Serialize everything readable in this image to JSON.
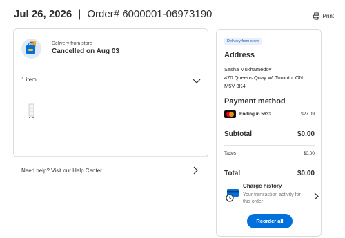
{
  "header": {
    "date": "Jul 26, 2026",
    "separator": "|",
    "order_label": "Order# 6000001-06973190",
    "print_label": "Print"
  },
  "order_card": {
    "fulfillment_sub": "Delivery from store",
    "status": "Cancelled on Aug 03",
    "items_count": "1 item",
    "help_text": "Need help? Visit our Help Center.",
    "icons": {
      "store": "shopping-bag-icon",
      "expand": "chevron-down-icon",
      "help": "chevron-right-icon"
    }
  },
  "summary": {
    "badge": "Delivery from store",
    "address_title": "Address",
    "address_name": "Sasha Mukhamedov",
    "address_line1": "470 Queens Quay W, Toronto, ON",
    "address_line2": "M5V 3K4",
    "payment_title": "Payment method",
    "card_ending": "Ending in 5633",
    "card_amount": "$27.09",
    "subtotal_label": "Subtotal",
    "subtotal_value": "$0.00",
    "taxes_label": "Taxes",
    "taxes_value": "$0.00",
    "total_label": "Total",
    "total_value": "$0.00",
    "charge_title": "Charge history",
    "charge_desc": "Your transaction activity for this order",
    "reorder_label": "Reorder all"
  },
  "colors": {
    "brand_blue": "#0071dc",
    "badge_bg": "#e8f0fb",
    "badge_text": "#2462b3",
    "text": "#2e2f32",
    "border": "#dadce0"
  }
}
